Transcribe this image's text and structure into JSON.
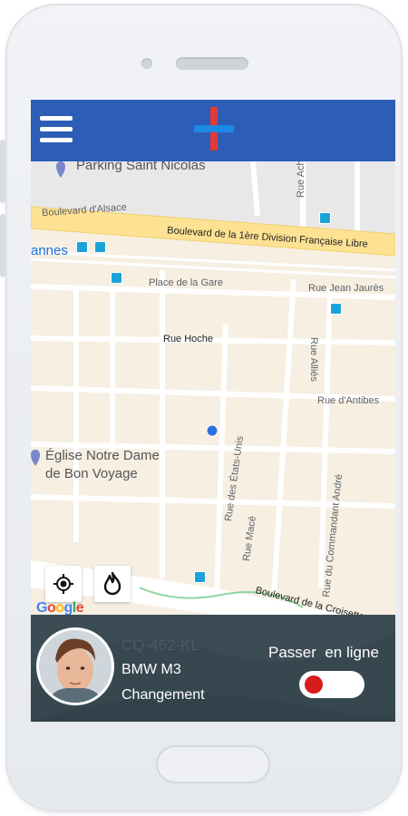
{
  "header": {
    "menu_icon": "hamburger-menu-icon",
    "logo_icon": "cross-logo-icon"
  },
  "map": {
    "labels": {
      "parking": "Parking Saint Nicolas",
      "bd_alsace": "Boulevard d'Alsace",
      "bd_division": "Boulevard de la 1ère Division Française Libre",
      "rue_achard": "Rue Achard",
      "cannes": "annes",
      "place_gare": "Place de la Gare",
      "rue_jean_jaures": "Rue Jean Jaurès",
      "rue_hoche": "Rue Hoche",
      "rue_allees": "Rue Alliés",
      "rue_antibes": "Rue d'Antibes",
      "eglise_1": "Église Notre Dame",
      "eglise_2": "de Bon Voyage",
      "rue_etats_unis": "Rue des États-Unis",
      "rue_commandant": "Rue du Commandant André",
      "rue_mace": "Rue Macé",
      "bd_croisette": "Boulevard de la Croisette",
      "google": "Google"
    },
    "controls": {
      "locate_icon": "crosshair-locate-icon",
      "flame_icon": "flame-icon"
    }
  },
  "driver_panel": {
    "plate": "CQ-462-KL",
    "car_model": "BMW M3",
    "status": "Changement",
    "online_label": "Passer  en ligne",
    "toggle_on": false,
    "colors": {
      "panel": "#37474f",
      "toggle_knob": "#d81b1b",
      "header": "#2c5db7"
    }
  }
}
